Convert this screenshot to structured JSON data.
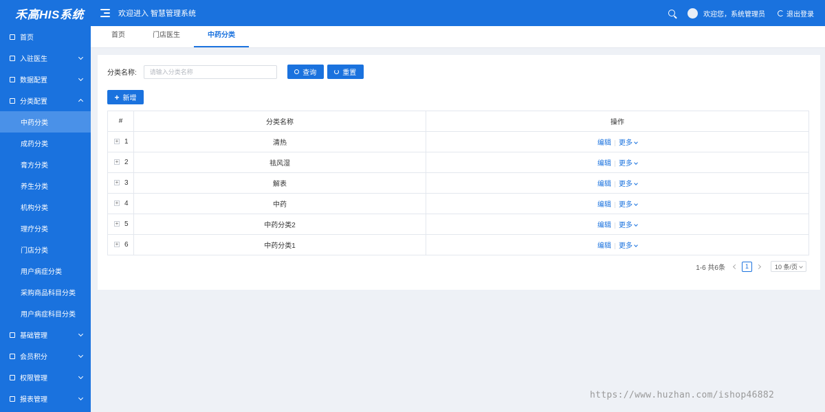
{
  "app": {
    "logo": "禾高HIS系统",
    "header_title": "欢迎进入 智慧管理系统",
    "greeting": "欢迎您，系统管理员",
    "logout_label": "退出登录"
  },
  "sidebar": {
    "items": [
      {
        "label": "首页",
        "icon": "home-icon"
      },
      {
        "label": "入驻医生",
        "icon": "doctor-icon"
      },
      {
        "label": "数据配置",
        "icon": "tag-icon"
      },
      {
        "label": "分类配置",
        "icon": "file-icon"
      }
    ],
    "sub_items": [
      "中药分类",
      "成药分类",
      "膏方分类",
      "养生分类",
      "机构分类",
      "理疗分类",
      "门店分类",
      "用户病症分类",
      "采购商品科目分类",
      "用户病症科目分类"
    ],
    "bottom_items": [
      {
        "label": "基础管理",
        "icon": "base-icon"
      },
      {
        "label": "会员积分",
        "icon": "folder-icon"
      },
      {
        "label": "权限管理",
        "icon": "key-icon"
      },
      {
        "label": "报表管理",
        "icon": "report-icon"
      }
    ]
  },
  "tabs": [
    "首页",
    "门店医生",
    "中药分类"
  ],
  "filter": {
    "label": "分类名称:",
    "placeholder": "请输入分类名称",
    "query_label": "查询",
    "reset_label": "重置",
    "add_label": "新增"
  },
  "table": {
    "headers": [
      "#",
      "分类名称",
      "操作"
    ],
    "rows": [
      {
        "index": "1",
        "name": "清热"
      },
      {
        "index": "2",
        "name": "祛风湿"
      },
      {
        "index": "3",
        "name": "解表"
      },
      {
        "index": "4",
        "name": "中药"
      },
      {
        "index": "5",
        "name": "中药分类2"
      },
      {
        "index": "6",
        "name": "中药分类1"
      }
    ],
    "edit_label": "编辑",
    "more_label": "更多"
  },
  "pagination": {
    "summary": "1-6 共6条",
    "current_page": "1",
    "page_size": "10 条/页"
  },
  "watermark": "https://www.huzhan.com/ishop46882",
  "colors": {
    "primary": "#1a72de",
    "sidebar_active": "#4a91e8"
  }
}
